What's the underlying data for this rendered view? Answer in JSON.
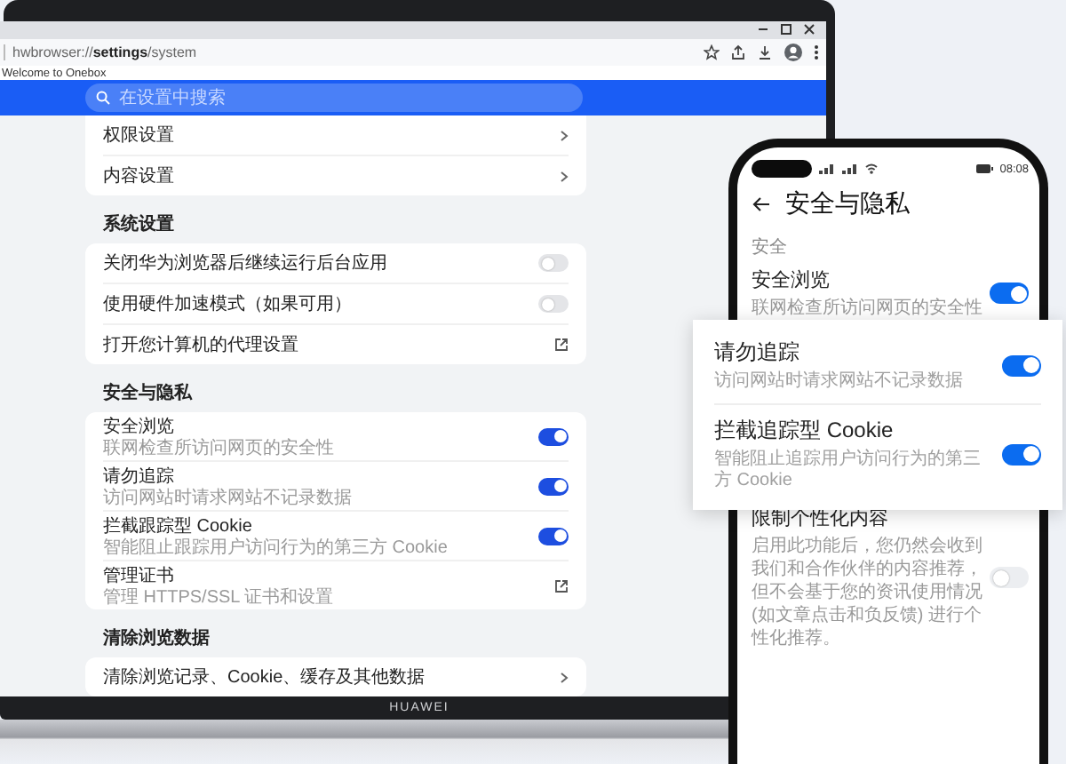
{
  "browser": {
    "address": "hwbrowser://**settings**/system",
    "bookmark": "Welcome to Onebox",
    "search": {
      "placeholder": "在设置中搜索"
    }
  },
  "sections": [
    {
      "items": [
        {
          "kind": "link",
          "label": "权限设置"
        },
        {
          "kind": "link",
          "label": "内容设置"
        }
      ]
    },
    {
      "title": "系统设置",
      "items": [
        {
          "kind": "toggle",
          "label": "关闭华为浏览器后继续运行后台应用",
          "on": false
        },
        {
          "kind": "toggle",
          "label": "使用硬件加速模式（如果可用）",
          "on": false
        },
        {
          "kind": "external",
          "label": "打开您计算机的代理设置"
        }
      ]
    },
    {
      "title": "安全与隐私",
      "items": [
        {
          "kind": "toggle",
          "label": "安全浏览",
          "description": "联网检查所访问网页的安全性",
          "on": true
        },
        {
          "kind": "toggle",
          "label": "请勿追踪",
          "description": "访问网站时请求网站不记录数据",
          "on": true
        },
        {
          "kind": "toggle",
          "label": "拦截跟踪型 Cookie",
          "description": "智能阻止跟踪用户访问行为的第三方 Cookie",
          "on": true
        },
        {
          "kind": "external",
          "label": "管理证书",
          "description": "管理 HTTPS/SSL 证书和设置"
        }
      ]
    },
    {
      "title": "清除浏览数据",
      "items": [
        {
          "kind": "link",
          "label": "清除浏览记录、Cookie、缓存及其他数据"
        }
      ]
    }
  ],
  "laptop_brand": "HUAWEI",
  "phone": {
    "time": "08:08",
    "title": "安全与隐私",
    "section": "安全",
    "items": [
      {
        "label": "安全浏览",
        "description": "联网检查所访问网页的安全性",
        "on": true
      },
      {
        "label": "限制个性化内容",
        "description": "启用此功能后，您仍然会收到我们和合作伙伴的内容推荐，但不会基于您的资讯使用情况 (如文章点击和负反馈) 进行个性化推荐。",
        "on": false
      }
    ]
  },
  "popup": {
    "items": [
      {
        "label": "请勿追踪",
        "description": "访问网站时请求网站不记录数据",
        "on": true
      },
      {
        "label": "拦截追踪型 Cookie",
        "description": "智能阻止追踪用户访问行为的第三方 Cookie",
        "on": true
      }
    ]
  }
}
